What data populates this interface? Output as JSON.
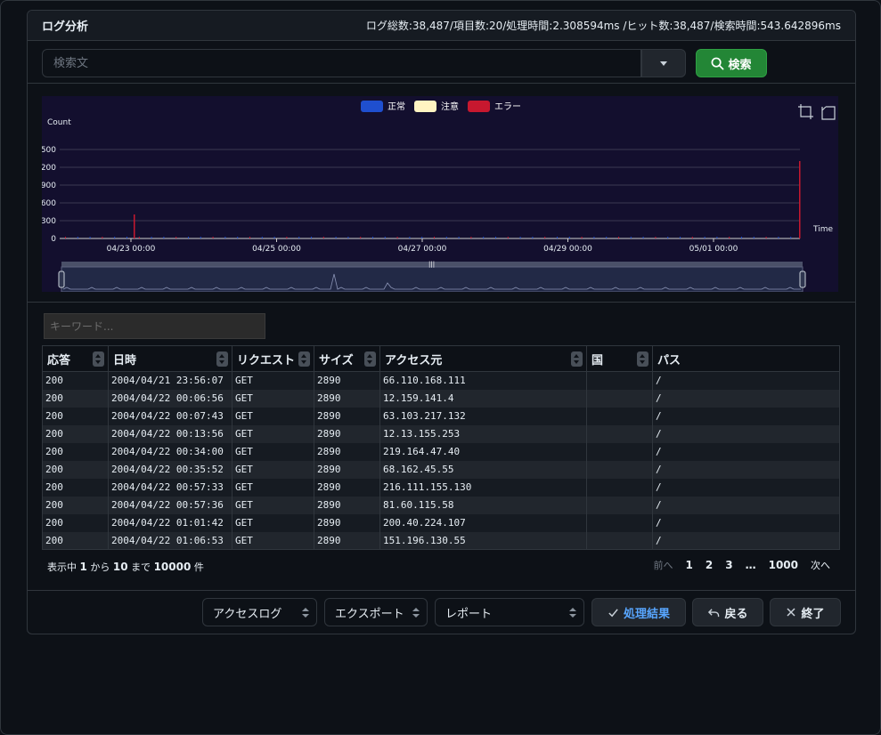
{
  "panel": {
    "title": "ログ分析",
    "stats": "ログ総数:38,487/項目数:20/処理時間:2.308594ms /ヒット数:38,487/検索時間:543.642896ms"
  },
  "search": {
    "placeholder": "検索文",
    "button_label": "検索",
    "button_icon": "search-icon",
    "dropdown_icon": "caret-down-icon"
  },
  "chart_data": {
    "type": "bar",
    "ylabel": "Count",
    "xlabel": "Time",
    "y_ticks": [
      "0",
      "300",
      "600",
      "900",
      "200",
      "500"
    ],
    "x_ticks": [
      "04/23 00:00",
      "04/25 00:00",
      "04/27 00:00",
      "04/29 00:00",
      "05/01 00:00"
    ],
    "legend": [
      {
        "name": "正常",
        "color": "#1f4fcf"
      },
      {
        "name": "注意",
        "color": "#fff4c2"
      },
      {
        "name": "エラー",
        "color": "#c7182f"
      }
    ],
    "legend_position": "top-center",
    "grid": true,
    "spikes": [
      {
        "x": "04/23 00:00",
        "series": "エラー",
        "height_fraction": 0.27
      },
      {
        "x": "05/02 12:00",
        "series": "エラー",
        "height_fraction": 0.87
      }
    ],
    "toolbar_icons": [
      "zoom-select-icon",
      "zoom-reset-icon"
    ],
    "has_range_slider": true
  },
  "table": {
    "keyword_placeholder": "キーワード...",
    "columns": [
      "応答",
      "日時",
      "リクエスト",
      "サイズ",
      "アクセス元",
      "国",
      "パス"
    ],
    "rows": [
      [
        "200",
        "2004/04/21 23:56:07",
        "GET",
        "2890",
        "66.110.168.111",
        "",
        "/"
      ],
      [
        "200",
        "2004/04/22 00:06:56",
        "GET",
        "2890",
        "12.159.141.4",
        "",
        "/"
      ],
      [
        "200",
        "2004/04/22 00:07:43",
        "GET",
        "2890",
        "63.103.217.132",
        "",
        "/"
      ],
      [
        "200",
        "2004/04/22 00:13:56",
        "GET",
        "2890",
        "12.13.155.253",
        "",
        "/"
      ],
      [
        "200",
        "2004/04/22 00:34:00",
        "GET",
        "2890",
        "219.164.47.40",
        "",
        "/"
      ],
      [
        "200",
        "2004/04/22 00:35:52",
        "GET",
        "2890",
        "68.162.45.55",
        "",
        "/"
      ],
      [
        "200",
        "2004/04/22 00:57:33",
        "GET",
        "2890",
        "216.111.155.130",
        "",
        "/"
      ],
      [
        "200",
        "2004/04/22 00:57:36",
        "GET",
        "2890",
        "81.60.115.58",
        "",
        "/"
      ],
      [
        "200",
        "2004/04/22 01:01:42",
        "GET",
        "2890",
        "200.40.224.107",
        "",
        "/"
      ],
      [
        "200",
        "2004/04/22 01:06:53",
        "GET",
        "2890",
        "151.196.130.55",
        "",
        "/"
      ]
    ],
    "info": {
      "prefix": "表示中",
      "from": "1",
      "from_suffix": "から",
      "to": "10",
      "to_suffix": "まで",
      "total": "10000",
      "total_suffix": "件"
    },
    "pagination": {
      "prev": "前へ",
      "pages": [
        "1",
        "2",
        "3"
      ],
      "ellipsis": "…",
      "last": "1000",
      "next": "次へ"
    }
  },
  "footer": {
    "select_log": "アクセスログ",
    "select_export": "エクスポート",
    "select_report": "レポート",
    "result_button": "処理結果",
    "back_button": "戻る",
    "close_button": "終了"
  },
  "colors": {
    "background": "#0d1117",
    "header": "#161b22",
    "border": "#30363d",
    "accent_green": "#238636",
    "accent_blue": "#58a6ff",
    "chart_bg": "#130f2e"
  }
}
